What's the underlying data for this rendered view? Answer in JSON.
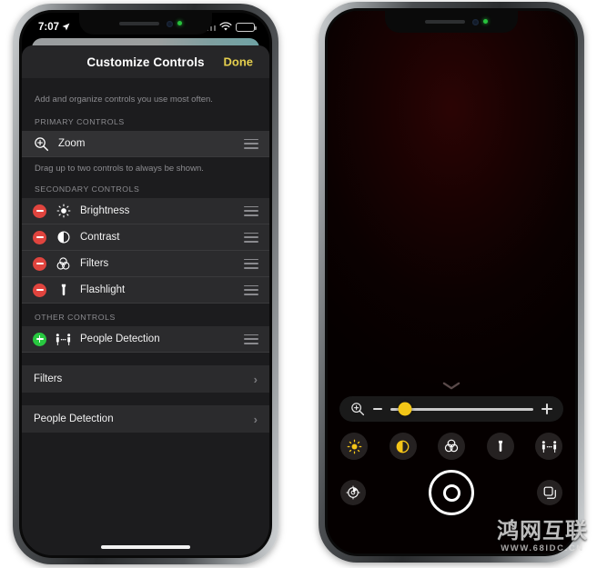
{
  "left_phone": {
    "status_bar": {
      "time": "7:07",
      "location_icon": "location-arrow-icon",
      "signal_icon": "cellular-signal-icon",
      "wifi_icon": "wifi-icon",
      "battery_icon": "battery-icon"
    },
    "sheet": {
      "title": "Customize Controls",
      "done_label": "Done",
      "subtitle": "Add and organize controls you use most often.",
      "sections": [
        {
          "header": "PRIMARY CONTROLS",
          "note": "Drag up to two controls to always be shown.",
          "rows": [
            {
              "label": "Zoom",
              "icon": "zoom-magnifier-icon",
              "accessory": "none",
              "grip": "reorder-grip-icon",
              "active": true
            }
          ]
        },
        {
          "header": "SECONDARY CONTROLS",
          "note": "",
          "rows": [
            {
              "label": "Brightness",
              "icon": "brightness-sun-icon",
              "accessory": "minus",
              "grip": "reorder-grip-icon",
              "active": false
            },
            {
              "label": "Contrast",
              "icon": "contrast-circle-icon",
              "accessory": "minus",
              "grip": "reorder-grip-icon",
              "active": false
            },
            {
              "label": "Filters",
              "icon": "filters-venn-icon",
              "accessory": "minus",
              "grip": "reorder-grip-icon",
              "active": false
            },
            {
              "label": "Flashlight",
              "icon": "flashlight-icon",
              "accessory": "minus",
              "grip": "reorder-grip-icon",
              "active": false
            }
          ]
        },
        {
          "header": "OTHER CONTROLS",
          "note": "",
          "rows": [
            {
              "label": "People Detection",
              "icon": "people-detection-icon",
              "accessory": "plus",
              "grip": "reorder-grip-icon",
              "active": false
            }
          ]
        }
      ],
      "nav_rows": [
        {
          "label": "Filters",
          "chevron": "chevron-right-icon"
        },
        {
          "label": "People Detection",
          "chevron": "chevron-right-icon"
        }
      ]
    }
  },
  "right_phone": {
    "camera_panel": {
      "handle_icon": "chevron-down-handle-icon",
      "zoom_slider": {
        "icon": "zoom-magnifier-icon",
        "decrease_icon": "minus-icon",
        "increase_icon": "plus-icon",
        "value_percent": 10,
        "thumb_color": "#f2c617",
        "track_color": "#c9c9c9"
      },
      "control_buttons": [
        {
          "name": "brightness-button",
          "icon": "brightness-sun-icon",
          "active": true
        },
        {
          "name": "contrast-button",
          "icon": "contrast-circle-icon",
          "active": true
        },
        {
          "name": "filters-button",
          "icon": "filters-venn-icon",
          "active": false
        },
        {
          "name": "flashlight-button",
          "icon": "flashlight-icon",
          "active": false
        },
        {
          "name": "people-detection-button",
          "icon": "people-detection-icon",
          "active": false
        }
      ],
      "bottom_buttons": [
        {
          "name": "settings-button",
          "icon": "settings-gear-icon"
        },
        {
          "name": "shutter-button",
          "icon": "shutter-circle-icon"
        },
        {
          "name": "gallery-button",
          "icon": "stacked-cards-icon"
        }
      ]
    }
  },
  "watermark": {
    "main": "鸿网互联",
    "sub": "WWW.68IDC.CN"
  },
  "colors": {
    "accent_yellow": "#e5cf4e",
    "slider_yellow": "#f2c617",
    "remove_red": "#e0443e",
    "add_green": "#28c840",
    "sheet_bg": "#1c1c1e",
    "row_bg": "#2b2b2d"
  }
}
